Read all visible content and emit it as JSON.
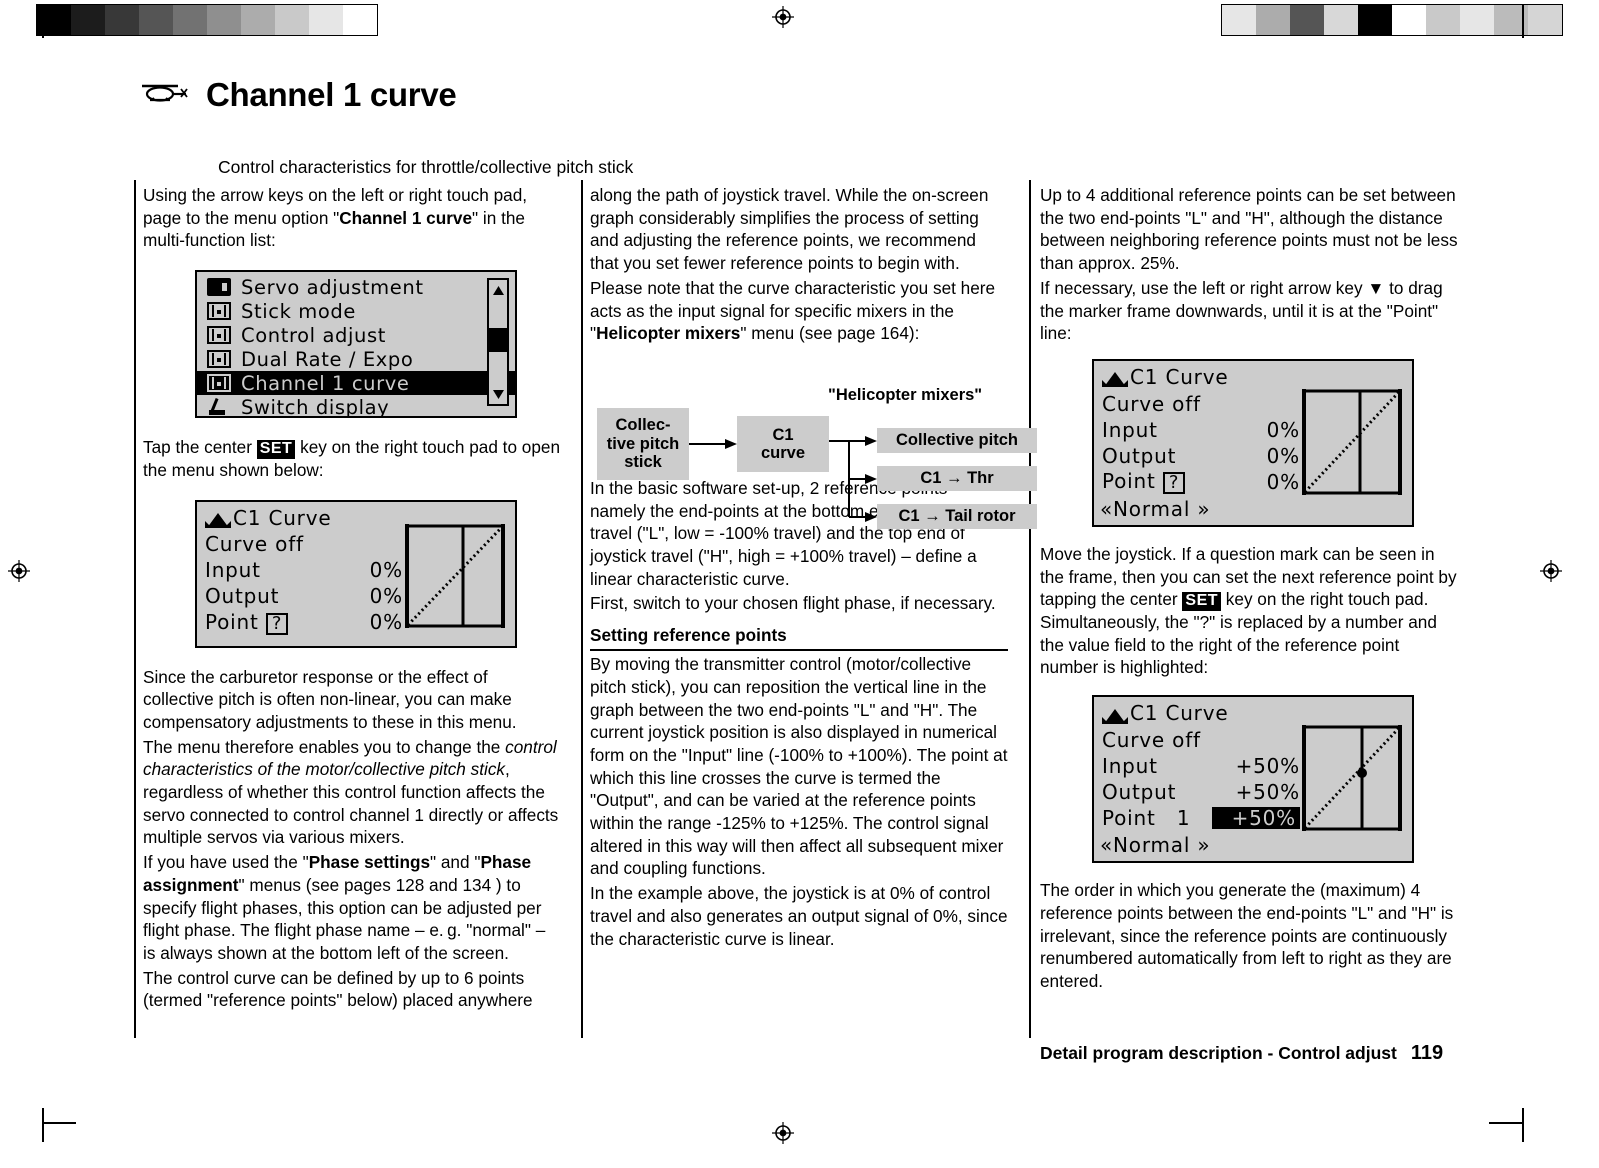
{
  "header": {
    "icon": "helicopter-icon",
    "title": "Channel 1 curve",
    "subtitle": "Control characteristics for throttle/collective pitch stick"
  },
  "colors": {
    "lcd_background": "#cccccc",
    "lcd_foreground": "#000000",
    "page_background": "#ffffff",
    "diagram_box": "#cccccc"
  },
  "column1": {
    "p1_a": "Using the arrow keys on the left or right touch pad, page to the menu option \"",
    "p1_b": "Channel 1 curve",
    "p1_c": "\" in the multi-function list:",
    "menu_screen": {
      "items": [
        {
          "icon": "servo-adjustment-icon",
          "label": "Servo adjustment",
          "selected": false
        },
        {
          "icon": "stick-mode-icon",
          "label": "Stick mode",
          "selected": false
        },
        {
          "icon": "control-adjust-icon",
          "label": "Control adjust",
          "selected": false
        },
        {
          "icon": "dual-rate-expo-icon",
          "label": "Dual Rate / Expo",
          "selected": false
        },
        {
          "icon": "channel-1-curve-icon",
          "label": "Channel 1 curve",
          "selected": true
        },
        {
          "icon": "switch-display-icon",
          "label": "Switch display",
          "selected": false
        }
      ],
      "scrollbar": {
        "up_arrow": "▲",
        "down_arrow": "▼"
      }
    },
    "p2_a": "Tap the center ",
    "p2_key": "SET",
    "p2_b": " key on the right touch pad to open the menu shown below:",
    "curve_screen": {
      "title": "C1  Curve",
      "curve_state": "Curve off",
      "rows": [
        {
          "label": "Input",
          "value": "0%"
        },
        {
          "label": "Output",
          "value": "0%"
        },
        {
          "label": "Point",
          "marker": "?",
          "value": "0%",
          "highlighted": false
        }
      ]
    },
    "p3": "Since the carburetor response or the effect of collective pitch is often non-linear, you can make compensatory adjustments to these in this menu.",
    "p4_a": "The menu therefore enables you to change the ",
    "p4_i": "control characteristics of the motor/collective pitch stick",
    "p4_b": ", regardless of whether this control function affects the servo connected to control channel 1 directly or affects multiple servos via various mixers.",
    "p5_a": "If you have used the \"",
    "p5_b1": "Phase settings",
    "p5_b": "\" and \"",
    "p5_b2": "Phase assignment",
    "p5_c": "\" menus (see pages 128 and 134 ) to specify flight phases, this option can be adjusted per flight phase. The flight phase name – e. g. \"normal\" – is always shown at the bottom left of the screen.",
    "p6": "The control curve can be defined by up to 6 points (termed \"reference points\" below) placed anywhere"
  },
  "column2": {
    "p1": "along the path of joystick travel. While the on-screen graph considerably simplifies the process of setting and adjusting the reference points, we recommend that you set fewer reference points to begin with.",
    "p2_a": "Please note that the curve characteristic you set here acts as the input signal for specific mixers in the \"",
    "p2_b": "Helicopter mixers",
    "p2_c": "\" menu (see page 164):",
    "diagram": {
      "label": "\"Helicopter mixers\"",
      "source": "Collec-\ntive pitch\nstick",
      "middle": "C1\ncurve",
      "outputs": [
        "Collective pitch",
        "C1 → Thr",
        "C1 → Tail rotor"
      ]
    },
    "p3": "In the basic software set-up, 2 reference points – namely the end-points at the bottom end of joystick travel (\"L\", low = -100% travel) and the top end of joystick travel (\"H\", high = +100% travel) – define a linear characteristic curve.",
    "p4": "First, switch to your chosen flight phase, if necessary.",
    "subhead": "Setting reference points",
    "p5": "By moving the transmitter control (motor/collective pitch stick), you can reposition the vertical line in the graph between the two end-points \"L\" and \"H\". The current joystick position is also displayed in numerical form on the \"Input\" line (-100% to +100%). The point at which this line crosses the curve is termed the \"Output\", and can be varied at the reference points within the range -125% to +125%. The control signal altered in this way will then affect all subsequent mixer and coupling functions.",
    "p6": "In the example above, the joystick is at 0% of control travel and also generates an output signal of 0%, since the characteristic curve is linear."
  },
  "column3": {
    "p1": "Up to 4 additional reference points can be set between the two end-points \"L\" and \"H\", although the distance between neighboring reference points must not be less than approx. 25%.",
    "p2_a": "If necessary, use the left or right arrow key ",
    "p2_arrow": "▼",
    "p2_b": " to drag the marker frame downwards, until it is at the \"Point\" line:",
    "curve_screen_1": {
      "title": "C1  Curve",
      "curve_state": "Curve off",
      "rows": [
        {
          "label": "Input",
          "value": "0%"
        },
        {
          "label": "Output",
          "value": "0%"
        },
        {
          "label": "Point",
          "marker": "?",
          "value": "0%",
          "highlighted": false
        }
      ],
      "phase": "«Normal  »"
    },
    "p3_a": "Move the joystick. If a question mark can be seen in the frame, then you can set the next reference point by tapping the center ",
    "p3_key": "SET",
    "p3_b": " key on the right touch pad. Simultaneously, the \"?\" is replaced by a number and the value field to the right of the reference point number is highlighted:",
    "curve_screen_2": {
      "title": "C1  Curve",
      "curve_state": "Curve off",
      "rows": [
        {
          "label": "Input",
          "value": "+50%"
        },
        {
          "label": "Output",
          "value": "+50%"
        },
        {
          "label": "Point",
          "marker": "1",
          "value": "+50%",
          "highlighted": true
        }
      ],
      "phase": "«Normal  »"
    },
    "p4": "The order in which you generate the (maximum) 4 reference points between the end-points \"L\" and \"H\" is irrelevant, since the reference points are continuously renumbered automatically from left to right as they are entered."
  },
  "footer": {
    "text": "Detail program description - Control adjust",
    "page": "119"
  }
}
